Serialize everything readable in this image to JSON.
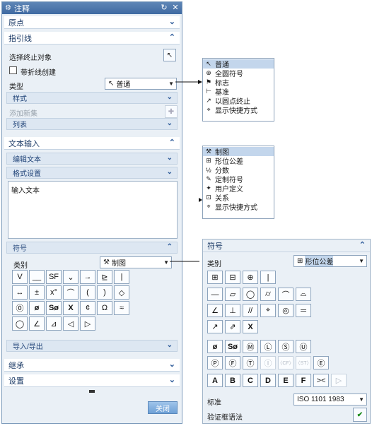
{
  "dialog": {
    "title": "注释",
    "sections": {
      "origin": "原点",
      "leader": "指引线",
      "select_terminating": "选择终止对象",
      "with_break": "带折线创建",
      "type_label": "类型",
      "type_value": "普通",
      "style": "样式",
      "add_new_set": "添加新集",
      "list": "列表",
      "text_input": "文本输入",
      "edit_text": "编辑文本",
      "format_setting": "格式设置",
      "input_text": "输入文本",
      "symbols": "符号",
      "category_label": "类别",
      "category_value": "制图",
      "import_export": "导入/导出",
      "inherit": "继承",
      "settings": "设置"
    },
    "symbol_buttons": [
      "V",
      "__",
      "SF",
      "⌄",
      "→",
      "⊵",
      "|",
      "↔",
      "±",
      "x°",
      "⌒",
      "(",
      ")",
      "◇",
      "⓪",
      "ø",
      "Sø",
      "X",
      "¢",
      "Ω",
      "≈",
      "◯",
      "∠",
      "⊿",
      "◁",
      "▷"
    ],
    "close_label": "关闭"
  },
  "type_menu": {
    "items": [
      {
        "label": "普通",
        "icon": "leader-plain-icon",
        "selected": true
      },
      {
        "label": "全圆符号",
        "icon": "all-around-icon",
        "selected": false
      },
      {
        "label": "标志",
        "icon": "flag-icon",
        "selected": false
      },
      {
        "label": "基准",
        "icon": "datum-icon",
        "selected": false
      },
      {
        "label": "以圆点终止",
        "icon": "dot-terminated-icon",
        "selected": false
      },
      {
        "label": "显示快捷方式",
        "icon": "shortcut-icon",
        "selected": false
      }
    ]
  },
  "category_menu": {
    "items": [
      {
        "label": "制图",
        "icon": "drafting-icon",
        "selected": true
      },
      {
        "label": "形位公差",
        "icon": "gdt-icon",
        "selected": false
      },
      {
        "label": "分数",
        "icon": "fraction-icon",
        "selected": false
      },
      {
        "label": "定制符号",
        "icon": "custom-symbol-icon",
        "selected": false
      },
      {
        "label": "用户定义",
        "icon": "user-defined-icon",
        "selected": false
      },
      {
        "label": "关系",
        "icon": "relation-icon",
        "selected": false
      },
      {
        "label": "显示快捷方式",
        "icon": "shortcut-icon",
        "selected": false
      }
    ]
  },
  "symbol_panel": {
    "header": "符号",
    "category_label": "类别",
    "category_value": "形位公差",
    "row1": [
      "⊞",
      "⊟",
      "⊕",
      "|"
    ],
    "row2": [
      "—",
      "▱",
      "◯",
      "⌭",
      "⌒",
      "⌓"
    ],
    "row3": [
      "∠",
      "⊥",
      "//",
      "⌖",
      "◎",
      "═"
    ],
    "row4": [
      "↗",
      "⇗",
      "X"
    ],
    "row5": [
      "ø",
      "Sø",
      "Ⓜ",
      "Ⓛ",
      "Ⓢ",
      "Ⓤ"
    ],
    "row6": [
      "Ⓟ",
      "Ⓕ",
      "Ⓣ",
      "Ⓘ",
      "〈CF〉",
      "〈ST〉",
      "Ⓔ"
    ],
    "row7": [
      "A",
      "B",
      "C",
      "D",
      "E",
      "F",
      "><",
      "▷"
    ],
    "standard_label": "标准",
    "standard_value": "ISO 1101 1983",
    "validate_label": "验证框语法"
  }
}
